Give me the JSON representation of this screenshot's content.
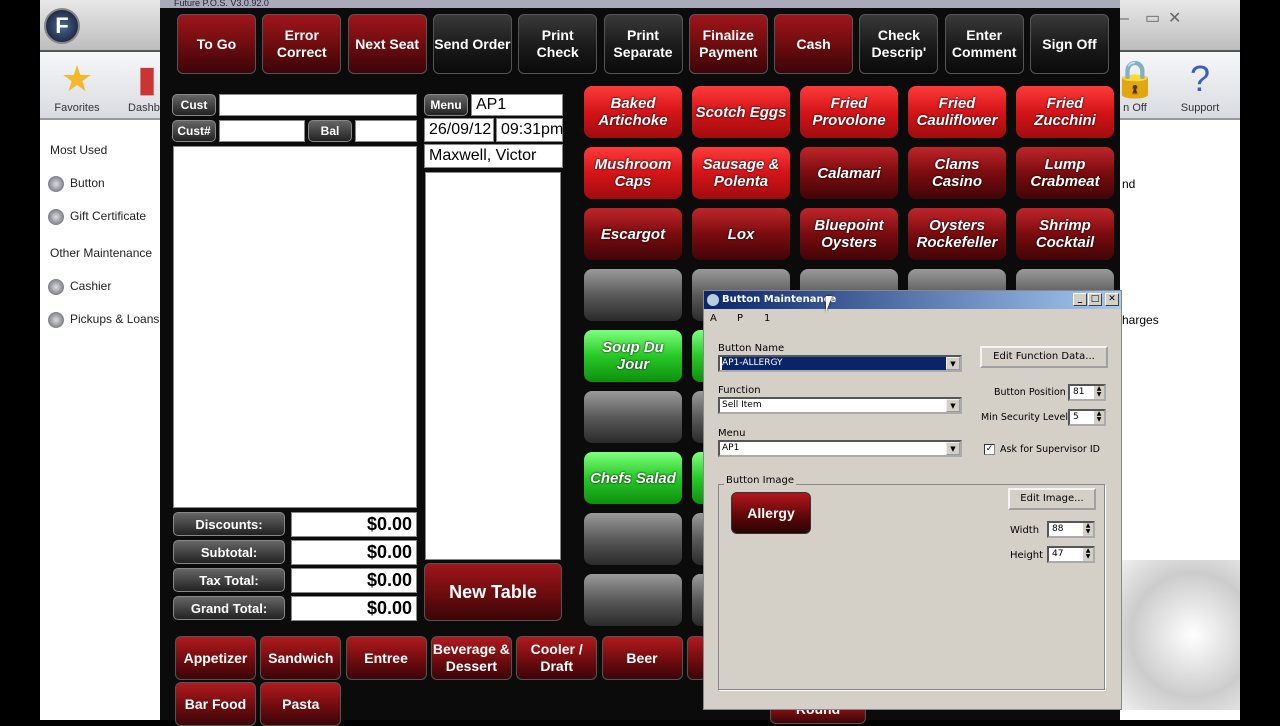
{
  "back_app": {
    "toolbar": [
      {
        "label": "Favorites",
        "icon": "star-icon"
      },
      {
        "label": "Dashbo",
        "icon": "chart-icon"
      },
      {
        "label": "n Off",
        "icon": "lock-icon"
      },
      {
        "label": "Support",
        "icon": "help-book-icon"
      }
    ],
    "sidebar": {
      "most_used": "Most Used",
      "items1": [
        "Button",
        "Gift Certificate"
      ],
      "other": "Other Maintenance",
      "items2": [
        "Cashier",
        "Pickups & Loans"
      ]
    },
    "right_frag": [
      "nd",
      "harges"
    ]
  },
  "pos": {
    "title": "Future P.O.S. V3.0.92.0",
    "top_buttons": [
      "To Go",
      "Error Correct",
      "Next Seat",
      "Send Order",
      "Print Check",
      "Print Separate",
      "Finalize Payment",
      "Cash",
      "Check Descrip'",
      "Enter Comment",
      "Sign Off"
    ],
    "cust_label": "Cust",
    "custnum_label": "Cust#",
    "bal_label": "Bal",
    "menu_label": "Menu",
    "menu_value": "AP1",
    "date": "26/09/12",
    "time": "09:31pm",
    "server": "Maxwell, Victor",
    "totals": [
      {
        "label": "Discounts:",
        "value": "$0.00"
      },
      {
        "label": "Subtotal:",
        "value": "$0.00"
      },
      {
        "label": "Tax Total:",
        "value": "$0.00"
      },
      {
        "label": "Grand Total:",
        "value": "$0.00"
      }
    ],
    "new_table": "New Table",
    "items": [
      [
        "Baked Artichoke",
        "Scotch Eggs",
        "Fried Provolone",
        "Fried Cauliflower",
        "Fried Zucchini"
      ],
      [
        "Mushroom Caps",
        "Sausage & Polenta",
        "Calamari",
        "Clams Casino",
        "Lump Crabmeat"
      ],
      [
        "Escargot",
        "Lox",
        "Bluepoint Oysters",
        "Oysters Rockefeller",
        "Shrimp Cocktail"
      ]
    ],
    "green_items": [
      "Soup Du Jour",
      "Chefs Salad"
    ],
    "categories": [
      "Appetizer",
      "Sandwich",
      "Entree",
      "Beverage & Dessert",
      "Cooler / Draft",
      "Beer"
    ],
    "categories2": [
      "Bar Food",
      "Pasta"
    ],
    "partial_label": "Round"
  },
  "dialog": {
    "title": "Button Maintenance",
    "menu": "AP1",
    "button_name_label": "Button Name",
    "button_name": "AP1-ALLERGY",
    "function_label": "Function",
    "function": "Sell Item",
    "menu_label": "Menu",
    "edit_function": "Edit Function Data...",
    "position_label": "Button Position",
    "position": "81",
    "security_label": "Min Security Level",
    "security": "5",
    "supervisor_label": "Ask for Supervisor ID",
    "supervisor_checked": true,
    "image_group": "Button Image",
    "preview": "Allergy",
    "edit_image": "Edit Image...",
    "width_label": "Width",
    "width": "88",
    "height_label": "Height",
    "height": "47"
  }
}
